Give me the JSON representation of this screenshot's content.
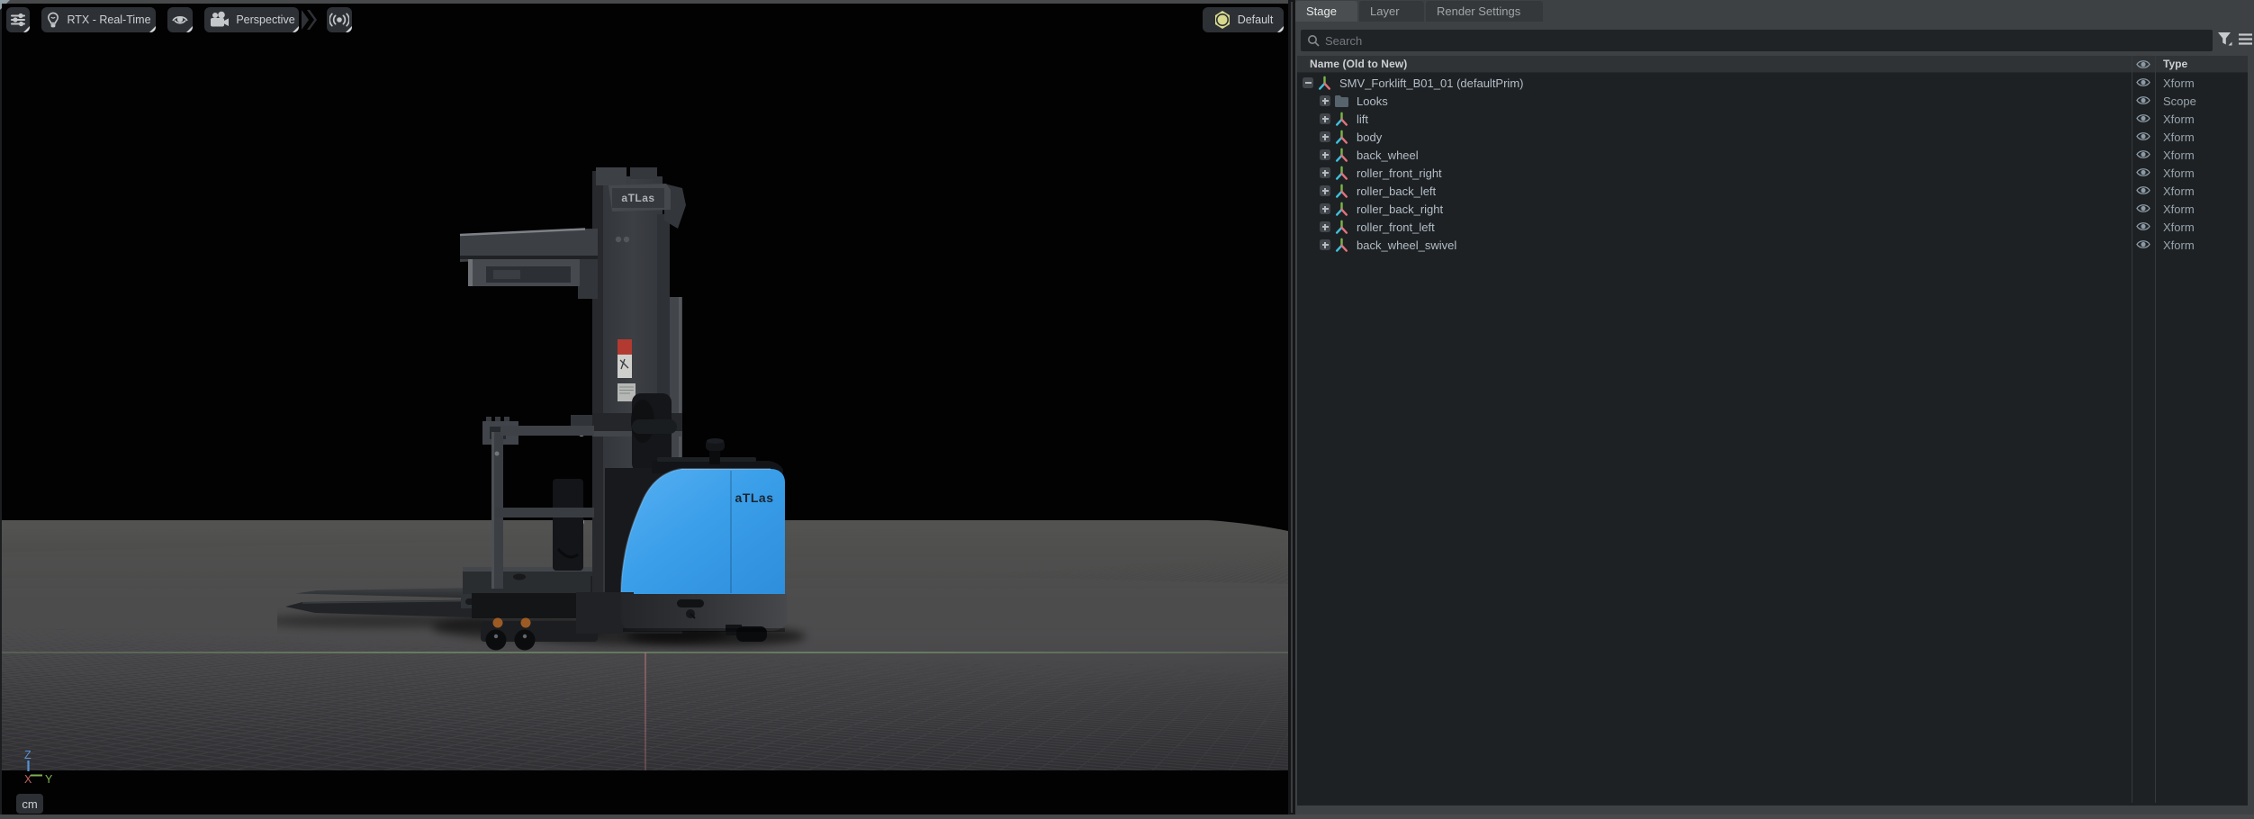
{
  "viewport": {
    "toolbar": {
      "renderer_label": "RTX - Real-Time",
      "camera_label": "Perspective",
      "lighting_label": "Default"
    },
    "unit_label": "cm",
    "axis_gizmo": {
      "x": "X",
      "y": "Y",
      "z": "Z"
    },
    "forklift": {
      "mast_brand": "aTLas",
      "body_brand": "aTLas"
    }
  },
  "panel": {
    "tabs": {
      "stage": "Stage",
      "layer": "Layer",
      "render": "Render Settings"
    },
    "search_placeholder": "Search",
    "columns": {
      "name": "Name (Old to New)",
      "type": "Type"
    },
    "tree": [
      {
        "name": "SMV_Forklift_B01_01 (defaultPrim)",
        "type": "Xform",
        "icon": "xform",
        "depth": 0,
        "expander": "minus"
      },
      {
        "name": "Looks",
        "type": "Scope",
        "icon": "folder",
        "depth": 1,
        "expander": "plus"
      },
      {
        "name": "lift",
        "type": "Xform",
        "icon": "xform",
        "depth": 1,
        "expander": "plus"
      },
      {
        "name": "body",
        "type": "Xform",
        "icon": "xform",
        "depth": 1,
        "expander": "plus"
      },
      {
        "name": "back_wheel",
        "type": "Xform",
        "icon": "xform",
        "depth": 1,
        "expander": "plus"
      },
      {
        "name": "roller_front_right",
        "type": "Xform",
        "icon": "xform",
        "depth": 1,
        "expander": "plus"
      },
      {
        "name": "roller_back_left",
        "type": "Xform",
        "icon": "xform",
        "depth": 1,
        "expander": "plus"
      },
      {
        "name": "roller_back_right",
        "type": "Xform",
        "icon": "xform",
        "depth": 1,
        "expander": "plus"
      },
      {
        "name": "roller_front_left",
        "type": "Xform",
        "icon": "xform",
        "depth": 1,
        "expander": "plus"
      },
      {
        "name": "back_wheel_swivel",
        "type": "Xform",
        "icon": "xform",
        "depth": 1,
        "expander": "plus"
      }
    ]
  },
  "colors": {
    "accent_blue_body": "#3b9fe9",
    "axis_x": "#c2635e",
    "axis_y": "#7fb353",
    "axis_z": "#5794d6",
    "lighting_icon": "#d8d98c"
  }
}
